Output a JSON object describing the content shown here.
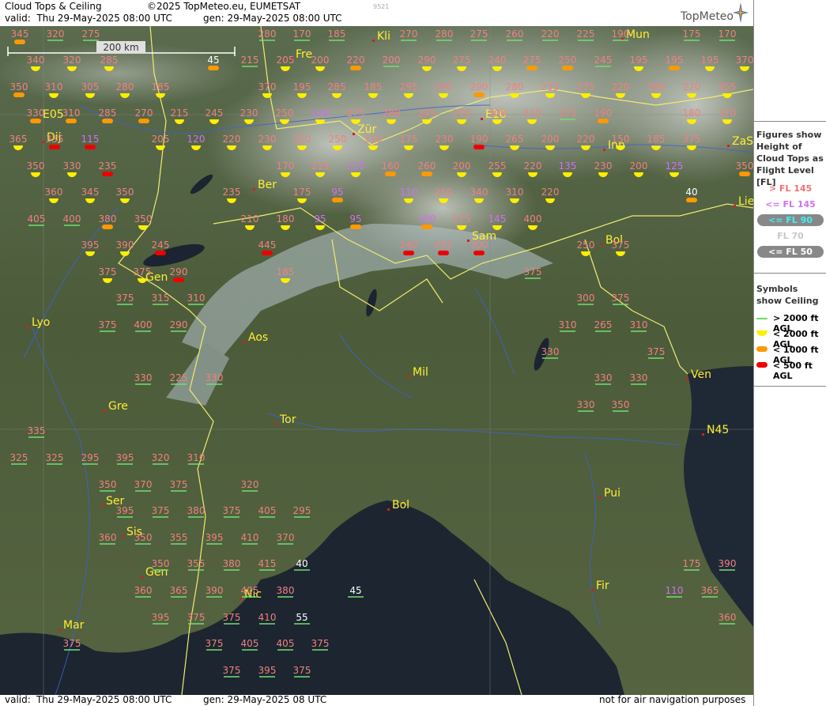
{
  "header": {
    "product": "Cloud Tops & Ceiling",
    "copyright": "©2025 TopMeteo.eu, EUMETSAT",
    "valid_label": "valid:",
    "valid_time": "Thu   29-May-2025   08:00 UTC",
    "gen": "gen: 29-May-2025 08:00 UTC",
    "code": "9521",
    "logo": "TopMeteo"
  },
  "scale": {
    "label": "200 km"
  },
  "footer": {
    "valid_label": "valid:",
    "valid_time": "Thu   29-May-2025   08:00 UTC",
    "gen": "gen: 29-May-2025 08 UTC",
    "disclaimer": "not for air navigation purposes"
  },
  "legend": {
    "figures_title": "Figures show Height of Cloud Tops as Flight Level  [FL]",
    "levels": [
      {
        "label": "> FL 145",
        "color": "#f07070"
      },
      {
        "label": "<= FL 145",
        "color": "#d070f0"
      },
      {
        "label": "<= FL 90",
        "color": "#40f0f0"
      },
      {
        "label": "FL 70",
        "color": "#c8c8c8"
      },
      {
        "label": "<= FL 50",
        "color": "#ffffff"
      }
    ],
    "symbols_title": "Symbols show Ceiling",
    "symbols": [
      {
        "label": "> 2000 ft AGL",
        "color": "#60e060"
      },
      {
        "label": "< 2000 ft AGL",
        "color": "#ffee00"
      },
      {
        "label": "< 1000 ft AGL",
        "color": "#ff9900"
      },
      {
        "label": "< 500 ft AGL",
        "color": "#ee0000"
      }
    ]
  },
  "map_labels": [
    "Fre",
    "Kli",
    "Mun",
    "Dij",
    "Zür",
    "Inn",
    "ZaS",
    "Ber",
    "Lie",
    "Sam",
    "Bol",
    "Gen",
    "Lyo",
    "Aos",
    "Mil",
    "Ven",
    "Gre",
    "Tor",
    "N45",
    "Ser",
    "Sis",
    "Gen",
    "Bol",
    "Pui",
    "Nic",
    "Fir",
    "Mar",
    "E05",
    "E10"
  ],
  "observations": [
    [
      "345",
      "p"
    ],
    [
      "320",
      "p"
    ],
    [
      "275",
      "p"
    ],
    [
      "280",
      "p"
    ],
    [
      "170",
      "p"
    ],
    [
      "185",
      "p"
    ],
    [
      "270",
      "p"
    ],
    [
      "280",
      "p"
    ],
    [
      "275",
      "p"
    ],
    [
      "260",
      "p"
    ],
    [
      "220",
      "p"
    ],
    [
      "225",
      "p"
    ],
    [
      "190",
      "p"
    ],
    [
      "175",
      "p"
    ],
    [
      "170",
      "p"
    ],
    [
      "340",
      "p"
    ],
    [
      "320",
      "p"
    ],
    [
      "285",
      "p"
    ],
    [
      "45",
      "w"
    ],
    [
      "215",
      "p"
    ],
    [
      "205",
      "p"
    ],
    [
      "200",
      "p"
    ],
    [
      "220",
      "p"
    ],
    [
      "200",
      "p"
    ],
    [
      "290",
      "p"
    ],
    [
      "275",
      "p"
    ],
    [
      "240",
      "p"
    ],
    [
      "275",
      "p"
    ],
    [
      "250",
      "p"
    ],
    [
      "245",
      "p"
    ],
    [
      "195",
      "p"
    ],
    [
      "195",
      "p"
    ],
    [
      "195",
      "p"
    ],
    [
      "370",
      "p"
    ],
    [
      "350",
      "p"
    ],
    [
      "310",
      "p"
    ],
    [
      "305",
      "p"
    ],
    [
      "280",
      "p"
    ],
    [
      "185",
      "p"
    ],
    [
      "370",
      "p"
    ],
    [
      "195",
      "p"
    ],
    [
      "285",
      "p"
    ],
    [
      "185",
      "p"
    ],
    [
      "295",
      "p"
    ],
    [
      "290",
      "p"
    ],
    [
      "290",
      "p"
    ],
    [
      "280",
      "p"
    ],
    [
      "235",
      "p"
    ],
    [
      "275",
      "p"
    ],
    [
      "220",
      "p"
    ],
    [
      "180",
      "p"
    ],
    [
      "220",
      "p"
    ],
    [
      "355",
      "p"
    ],
    [
      "330",
      "p"
    ],
    [
      "310",
      "p"
    ],
    [
      "285",
      "p"
    ],
    [
      "270",
      "p"
    ],
    [
      "215",
      "p"
    ],
    [
      "245",
      "p"
    ],
    [
      "230",
      "p"
    ],
    [
      "250",
      "p"
    ],
    [
      "140",
      "v"
    ],
    [
      "275",
      "p"
    ],
    [
      "280",
      "p"
    ],
    [
      "245",
      "p"
    ],
    [
      "270",
      "p"
    ],
    [
      "300",
      "p"
    ],
    [
      "310",
      "p"
    ],
    [
      "175",
      "p"
    ],
    [
      "190",
      "p"
    ],
    [
      "180",
      "p"
    ],
    [
      "370",
      "p"
    ],
    [
      "365",
      "p"
    ],
    [
      "335",
      "p"
    ],
    [
      "115",
      "v"
    ],
    [
      "205",
      "p"
    ],
    [
      "120",
      "v"
    ],
    [
      "220",
      "p"
    ],
    [
      "230",
      "p"
    ],
    [
      "220",
      "p"
    ],
    [
      "250",
      "p"
    ],
    [
      "210",
      "p"
    ],
    [
      "175",
      "p"
    ],
    [
      "230",
      "p"
    ],
    [
      "190",
      "p"
    ],
    [
      "265",
      "p"
    ],
    [
      "200",
      "p"
    ],
    [
      "220",
      "p"
    ],
    [
      "150",
      "p"
    ],
    [
      "185",
      "p"
    ],
    [
      "375",
      "p"
    ],
    [
      "350",
      "p"
    ],
    [
      "330",
      "p"
    ],
    [
      "235",
      "p"
    ],
    [
      "170",
      "p"
    ],
    [
      "215",
      "p"
    ],
    [
      "110",
      "v"
    ],
    [
      "160",
      "p"
    ],
    [
      "260",
      "p"
    ],
    [
      "200",
      "p"
    ],
    [
      "255",
      "p"
    ],
    [
      "220",
      "p"
    ],
    [
      "135",
      "v"
    ],
    [
      "230",
      "p"
    ],
    [
      "200",
      "p"
    ],
    [
      "125",
      "v"
    ],
    [
      "350",
      "p"
    ],
    [
      "360",
      "p"
    ],
    [
      "345",
      "p"
    ],
    [
      "350",
      "p"
    ],
    [
      "235",
      "p"
    ],
    [
      "175",
      "p"
    ],
    [
      "95",
      "v"
    ],
    [
      "110",
      "v"
    ],
    [
      "250",
      "p"
    ],
    [
      "340",
      "p"
    ],
    [
      "310",
      "p"
    ],
    [
      "220",
      "p"
    ],
    [
      "40",
      "w"
    ],
    [
      "405",
      "p"
    ],
    [
      "400",
      "p"
    ],
    [
      "380",
      "p"
    ],
    [
      "350",
      "p"
    ],
    [
      "210",
      "p"
    ],
    [
      "180",
      "p"
    ],
    [
      "95",
      "v"
    ],
    [
      "95",
      "v"
    ],
    [
      "100",
      "v"
    ],
    [
      "175",
      "p"
    ],
    [
      "145",
      "v"
    ],
    [
      "400",
      "p"
    ],
    [
      "395",
      "p"
    ],
    [
      "390",
      "p"
    ],
    [
      "245",
      "p"
    ],
    [
      "445",
      "p"
    ],
    [
      "240",
      "p"
    ],
    [
      "255",
      "p"
    ],
    [
      "300",
      "p"
    ],
    [
      "250",
      "p"
    ],
    [
      "375",
      "p"
    ],
    [
      "375",
      "p"
    ],
    [
      "375",
      "p"
    ],
    [
      "290",
      "p"
    ],
    [
      "185",
      "p"
    ],
    [
      "375",
      "p"
    ],
    [
      "375",
      "p"
    ],
    [
      "315",
      "p"
    ],
    [
      "310",
      "p"
    ],
    [
      "300",
      "p"
    ],
    [
      "375",
      "p"
    ],
    [
      "375",
      "p"
    ],
    [
      "400",
      "p"
    ],
    [
      "290",
      "p"
    ],
    [
      "310",
      "p"
    ],
    [
      "265",
      "p"
    ],
    [
      "310",
      "p"
    ],
    [
      "330",
      "p"
    ],
    [
      "375",
      "p"
    ],
    [
      "330",
      "p"
    ],
    [
      "225",
      "p"
    ],
    [
      "330",
      "p"
    ],
    [
      "330",
      "p"
    ],
    [
      "330",
      "p"
    ],
    [
      "330",
      "p"
    ],
    [
      "350",
      "p"
    ],
    [
      "335",
      "p"
    ],
    [
      "325",
      "p"
    ],
    [
      "325",
      "p"
    ],
    [
      "295",
      "p"
    ],
    [
      "395",
      "p"
    ],
    [
      "320",
      "p"
    ],
    [
      "310",
      "p"
    ],
    [
      "350",
      "p"
    ],
    [
      "370",
      "p"
    ],
    [
      "375",
      "p"
    ],
    [
      "320",
      "p"
    ],
    [
      "395",
      "p"
    ],
    [
      "375",
      "p"
    ],
    [
      "380",
      "p"
    ],
    [
      "375",
      "p"
    ],
    [
      "405",
      "p"
    ],
    [
      "295",
      "p"
    ],
    [
      "360",
      "p"
    ],
    [
      "350",
      "p"
    ],
    [
      "355",
      "p"
    ],
    [
      "395",
      "p"
    ],
    [
      "410",
      "p"
    ],
    [
      "370",
      "p"
    ],
    [
      "350",
      "p"
    ],
    [
      "355",
      "p"
    ],
    [
      "380",
      "p"
    ],
    [
      "415",
      "p"
    ],
    [
      "40",
      "w"
    ],
    [
      "175",
      "p"
    ],
    [
      "390",
      "p"
    ],
    [
      "360",
      "p"
    ],
    [
      "365",
      "p"
    ],
    [
      "390",
      "p"
    ],
    [
      "405",
      "p"
    ],
    [
      "380",
      "p"
    ],
    [
      "45",
      "w"
    ],
    [
      "110",
      "v"
    ],
    [
      "365",
      "p"
    ],
    [
      "395",
      "p"
    ],
    [
      "375",
      "p"
    ],
    [
      "375",
      "p"
    ],
    [
      "410",
      "p"
    ],
    [
      "55",
      "w"
    ],
    [
      "360",
      "p"
    ],
    [
      "375",
      "p"
    ],
    [
      "375",
      "p"
    ],
    [
      "405",
      "p"
    ],
    [
      "405",
      "p"
    ],
    [
      "375",
      "p"
    ],
    [
      "375",
      "p"
    ],
    [
      "395",
      "p"
    ],
    [
      "375",
      "p"
    ]
  ]
}
